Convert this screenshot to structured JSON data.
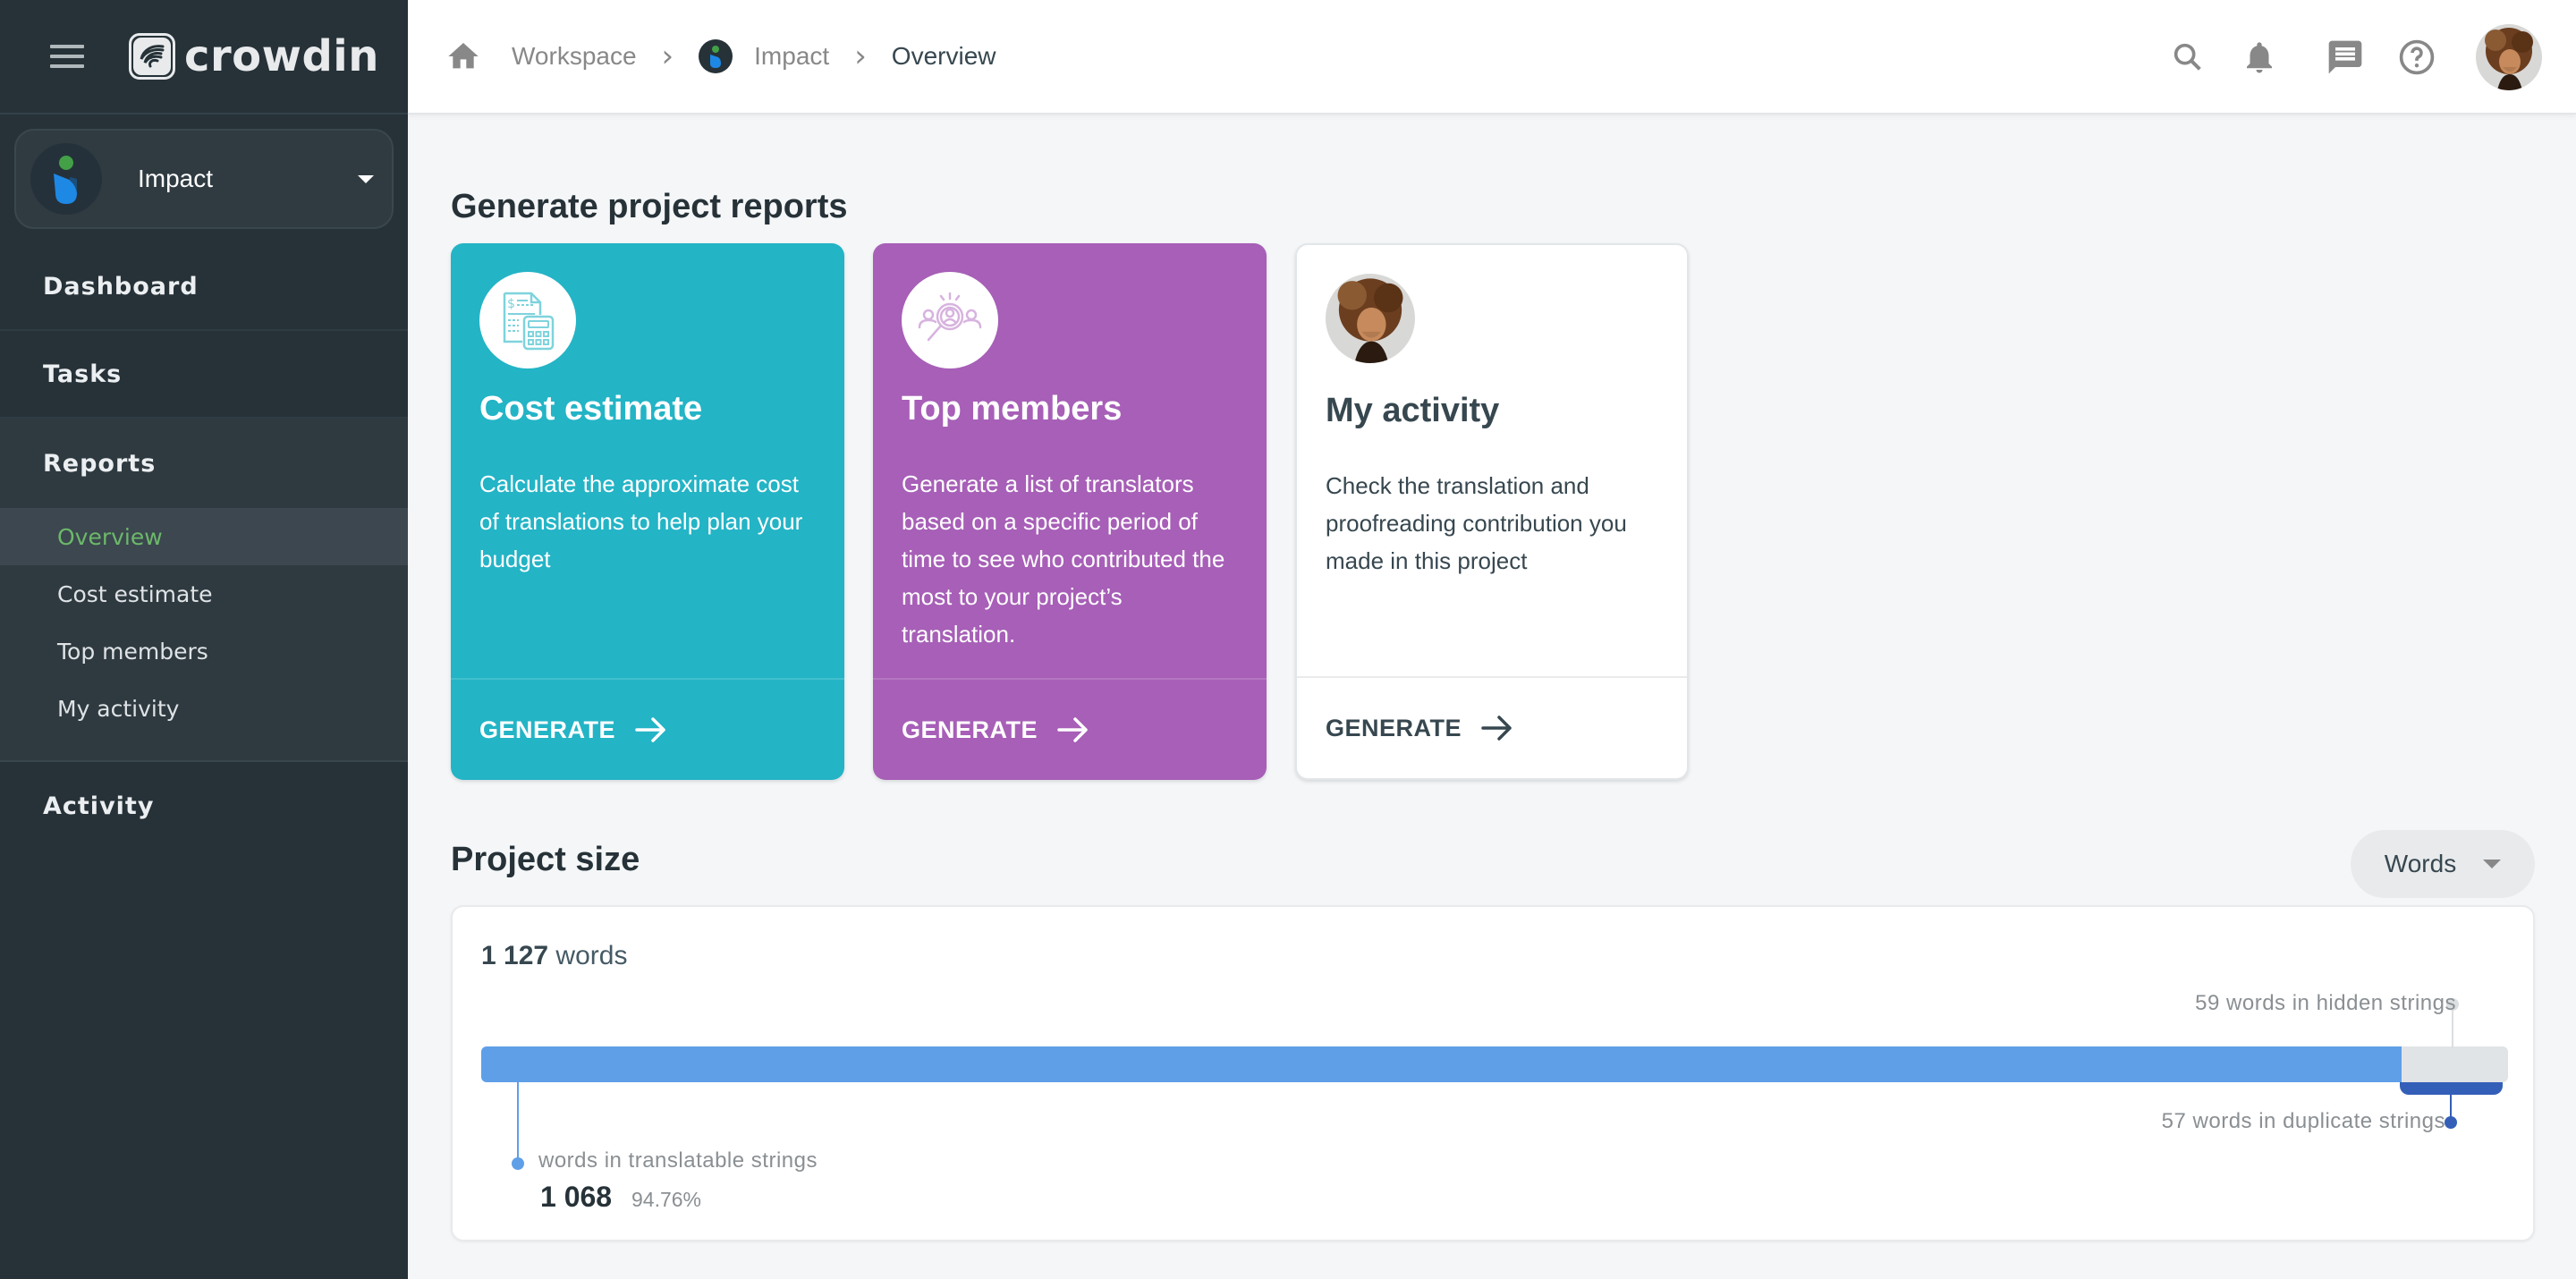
{
  "app": {
    "brand": "crowdin"
  },
  "sidebar": {
    "project": {
      "name": "Impact"
    },
    "nav": [
      {
        "label": "Dashboard"
      },
      {
        "label": "Tasks"
      },
      {
        "label": "Reports"
      },
      {
        "label": "Activity"
      }
    ],
    "reports_sub": [
      {
        "label": "Overview",
        "active": true
      },
      {
        "label": "Cost estimate",
        "active": false
      },
      {
        "label": "Top members",
        "active": false
      },
      {
        "label": "My activity",
        "active": false
      }
    ]
  },
  "header": {
    "breadcrumb": [
      {
        "label": "Workspace",
        "icon": "home-icon"
      },
      {
        "label": "Impact",
        "icon": "project-icon"
      },
      {
        "label": "Overview"
      }
    ],
    "icons": [
      "search-icon",
      "bell-icon",
      "chat-icon",
      "help-icon",
      "user-avatar"
    ]
  },
  "main": {
    "reports_title": "Generate project reports",
    "cards": [
      {
        "title": "Cost estimate",
        "description": "Calculate the approximate cost of translations to help plan your budget",
        "action": "GENERATE",
        "icon": "calculator-invoice-icon",
        "color": "#23b4c6"
      },
      {
        "title": "Top members",
        "description": "Generate a list of translators based on a specific period of time to see who contributed the most to your project’s translation.",
        "action": "GENERATE",
        "icon": "member-search-icon",
        "color": "#a75fb7"
      },
      {
        "title": "My activity",
        "description": "Check the translation and proofreading contribution you made in this project",
        "action": "GENERATE",
        "icon": "user-avatar",
        "color": "#ffffff"
      }
    ],
    "project_size": {
      "title": "Project size",
      "unit_select": "Words",
      "total_number": "1 127",
      "total_unit": "words",
      "translatable": {
        "label": "words in translatable strings",
        "value": "1 068",
        "percent": "94.76%",
        "count": 1068,
        "color": "#5f9fe8"
      },
      "hidden": {
        "label": "59 words in hidden strings",
        "count": 59,
        "color": "#e1e4e6"
      },
      "duplicate": {
        "label": "57 words in duplicate strings",
        "count": 57,
        "color": "#335fb8"
      },
      "total_count": 1127
    }
  }
}
